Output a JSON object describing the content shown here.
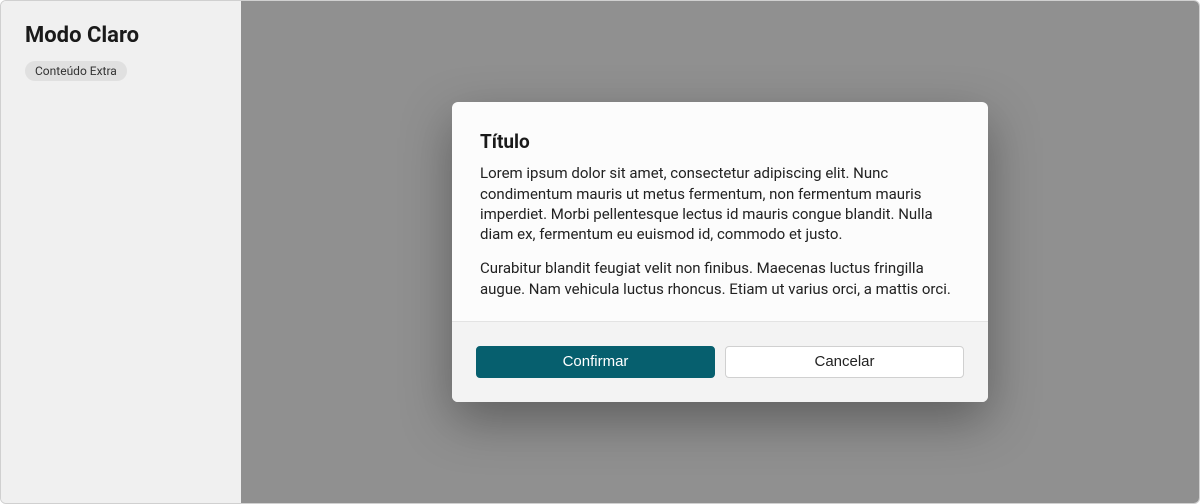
{
  "sidebar": {
    "title": "Modo Claro",
    "badge": "Conteúdo Extra"
  },
  "dialog": {
    "title": "Título",
    "paragraph1": "Lorem ipsum dolor sit amet, consectetur adipiscing elit. Nunc condimentum mauris ut metus fermentum, non fermentum mauris imperdiet. Morbi pellentesque lectus id mauris congue blandit. Nulla diam ex, fermentum eu euismod id, commodo et justo.",
    "paragraph2": "Curabitur blandit feugiat velit non finibus. Maecenas luctus fringilla augue. Nam vehicula luctus rhoncus. Etiam ut varius orci, a mattis orci.",
    "confirm_label": "Confirmar",
    "cancel_label": "Cancelar"
  }
}
